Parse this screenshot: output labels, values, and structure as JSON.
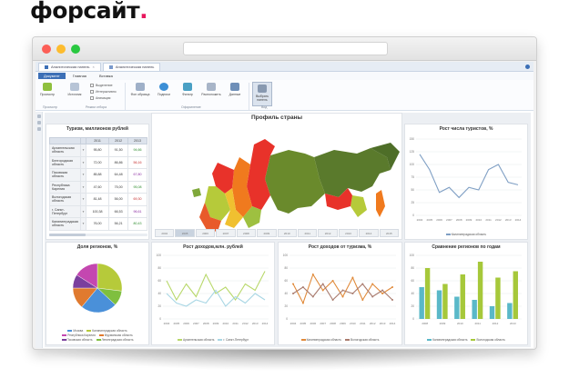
{
  "brand": {
    "name": "форсайт",
    "dot": ".",
    "dot_color": "#e8175d"
  },
  "app": {
    "tabs": [
      {
        "label": "Аналитическая панель"
      },
      {
        "label": "Аналитическая панель"
      }
    ],
    "ribbon_tabs": [
      {
        "label": "Документ",
        "active": true
      },
      {
        "label": "Главная"
      },
      {
        "label": "Вставка"
      }
    ],
    "ribbon": {
      "buttons": [
        {
          "label": "Просмотр",
          "icon": "view-icon"
        },
        {
          "label": "Источник",
          "icon": "source-icon"
        },
        {
          "label": "Фон образца",
          "icon": "background-icon"
        },
        {
          "label": "Подписи",
          "icon": "captions-icon"
        },
        {
          "label": "Фильтр",
          "icon": "filter-icon"
        },
        {
          "label": "Расположить",
          "icon": "arrange-icon"
        },
        {
          "label": "Данные",
          "icon": "data-icon"
        },
        {
          "label": "Выбрать панель",
          "icon": "select-panel-icon"
        }
      ],
      "options": [
        "Выделение",
        "Интерактивно",
        "Анимация"
      ],
      "groups": [
        "Просмотр",
        "Режим отбора",
        "Оформление",
        "Вид"
      ]
    },
    "accent": "#3c6fb6"
  },
  "dashboard": {
    "title": "Профиль страны",
    "table_panel": {
      "title": "Туризм, миллионов рублей",
      "columns": [
        "2011",
        "2012",
        "2013"
      ],
      "rows": [
        {
          "name": "Архангельская область",
          "v": [
            "95,80",
            "91,50",
            "94,66"
          ]
        },
        {
          "name": "Белгородская область",
          "v": [
            "72,00",
            "86,86",
            "56,16"
          ]
        },
        {
          "name": "Псковская область",
          "v": [
            "85,88",
            "64,48",
            "67,80"
          ]
        },
        {
          "name": "Республика Карелия",
          "v": [
            "47,60",
            "75,00",
            "95,08"
          ]
        },
        {
          "name": "Вологодская область",
          "v": [
            "81,48",
            "56,00",
            "69,30"
          ]
        },
        {
          "name": "г. Санкт-Петербург",
          "v": [
            "100,38",
            "66,53",
            "96,61"
          ]
        },
        {
          "name": "Калининградская область",
          "v": [
            "76,00",
            "56,21",
            "80,43"
          ]
        }
      ]
    },
    "map_panel": {
      "timeline": [
        "2004",
        "2005",
        "2006",
        "2007",
        "2008",
        "2009",
        "2010",
        "2011",
        "2012",
        "2013",
        "2014",
        "2015"
      ],
      "timeline_current": 1
    },
    "tourists_panel": {
      "title": "Рост числа туристов, %",
      "legend": [
        "Калининградская область"
      ]
    },
    "share_panel": {
      "title": "Доля регионов, %",
      "legend": [
        "Москва",
        "Калининградская область",
        "Республика Карелия",
        "Мурманская область",
        "Псковская область",
        "Ленинградская область"
      ]
    },
    "income_panel": {
      "title": "Рост доходов,млн. рублей",
      "legend": [
        "Архангельская область",
        "г. Санкт-Петербург"
      ]
    },
    "tourism_income_panel": {
      "title": "Рост доходов от туризма, %",
      "legend": [
        "Калининградская область",
        "Вологодская область"
      ]
    },
    "compare_panel": {
      "title": "Сравнение регионов по годам",
      "legend": [
        "Калининградская область",
        "Вологодская область"
      ]
    }
  },
  "chart_data": [
    {
      "type": "line",
      "title": "Рост числа туристов, %",
      "x": [
        "2004",
        "2005",
        "2006",
        "2007",
        "2008",
        "2009",
        "2010",
        "2011",
        "2012",
        "2013",
        "2014"
      ],
      "series": [
        {
          "name": "Калининградская область",
          "values": [
            120,
            90,
            45,
            55,
            35,
            55,
            50,
            90,
            100,
            65,
            60
          ]
        }
      ],
      "ylim": [
        0,
        150
      ],
      "yticks": [
        "0",
        "25",
        "50",
        "75",
        "100",
        "125",
        "150"
      ],
      "color": "#7f9fc4"
    },
    {
      "type": "pie",
      "title": "Доля регионов, %",
      "categories": [
        "Калининградская область",
        "Мурманская область",
        "Москва",
        "Ленинградская область",
        "Псковская область",
        "Республика Карелия"
      ],
      "values": [
        27,
        10,
        24,
        14,
        9,
        16
      ],
      "colors": [
        "#b6ca3a",
        "#7fbf3f",
        "#4a90d9",
        "#e07a2f",
        "#7b3f9e",
        "#c447b0"
      ]
    },
    {
      "type": "line",
      "title": "Рост доходов,млн. рублей",
      "x": [
        "2004",
        "2005",
        "2006",
        "2007",
        "2008",
        "2009",
        "2010",
        "2011",
        "2012",
        "2013",
        "2014"
      ],
      "series": [
        {
          "name": "Архангельская область",
          "values": [
            60,
            30,
            55,
            35,
            70,
            40,
            50,
            30,
            55,
            45,
            75
          ]
        },
        {
          "name": "г. Санкт-Петербург",
          "values": [
            40,
            25,
            20,
            30,
            25,
            45,
            20,
            35,
            25,
            40,
            30
          ]
        }
      ],
      "ylim": [
        0,
        100
      ],
      "yticks": [
        "0",
        "20",
        "40",
        "60",
        "80",
        "100"
      ],
      "colors": [
        "#b8d86a",
        "#a8d6e4"
      ]
    },
    {
      "type": "line",
      "title": "Рост доходов от туризма, %",
      "x": [
        "2004",
        "2005",
        "2006",
        "2007",
        "2008",
        "2009",
        "2010",
        "2011",
        "2012",
        "2013",
        "2014"
      ],
      "series": [
        {
          "name": "Калининградская область",
          "values": [
            55,
            25,
            70,
            45,
            60,
            35,
            65,
            30,
            55,
            40,
            50
          ]
        },
        {
          "name": "Вологодская область",
          "values": [
            40,
            50,
            35,
            55,
            30,
            45,
            40,
            55,
            35,
            45,
            30
          ]
        }
      ],
      "ylim": [
        0,
        100
      ],
      "yticks": [
        "0",
        "20",
        "40",
        "60",
        "80",
        "100"
      ],
      "colors": [
        "#e08a3a",
        "#a97b6e"
      ]
    },
    {
      "type": "bar",
      "title": "Сравнение регионов по годам",
      "categories": [
        "2008",
        "2009",
        "2010",
        "2011",
        "2012",
        "2013"
      ],
      "series": [
        {
          "name": "Калининградская область",
          "values": [
            50,
            45,
            35,
            30,
            20,
            25
          ]
        },
        {
          "name": "Вологодская область",
          "values": [
            80,
            55,
            70,
            90,
            65,
            75
          ]
        }
      ],
      "ylim": [
        0,
        100
      ],
      "yticks": [
        "0",
        "20",
        "40",
        "60",
        "80",
        "100"
      ],
      "colors": [
        "#5ab8c8",
        "#a6c83a"
      ]
    }
  ]
}
